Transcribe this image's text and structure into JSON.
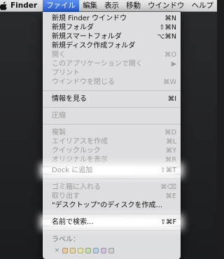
{
  "menubar": {
    "apple_icon": "apple-icon",
    "app_name": "Finder",
    "menus": [
      "ファイル",
      "編集",
      "表示",
      "移動",
      "ウインドウ",
      "ヘルプ"
    ]
  },
  "file_menu": {
    "items": [
      {
        "label": "新規 Finder ウインドウ",
        "shortcut": "⌘N",
        "enabled": true
      },
      {
        "label": "新規フォルダ",
        "shortcut": "⇧⌘N",
        "enabled": true
      },
      {
        "label": "新規スマートフォルダ",
        "shortcut": "⌥⌘N",
        "enabled": true
      },
      {
        "label": "新規ディスク作成フォルダ",
        "shortcut": "",
        "enabled": true
      },
      {
        "label": "開く",
        "shortcut": "⌘O",
        "enabled": false
      },
      {
        "label": "このアプリケーションで開く",
        "shortcut": "▶",
        "enabled": false
      },
      {
        "label": "プリント",
        "shortcut": "",
        "enabled": false
      },
      {
        "label": "ウインドウを閉じる",
        "shortcut": "⌘W",
        "enabled": false
      },
      {
        "label": "情報を見る",
        "shortcut": "⌘I",
        "enabled": true
      },
      {
        "label": "圧縮",
        "shortcut": "",
        "enabled": false
      },
      {
        "label": "複製",
        "shortcut": "⌘D",
        "enabled": false
      },
      {
        "label": "エイリアスを作成",
        "shortcut": "⌘L",
        "enabled": false
      },
      {
        "label": "クイックルック",
        "shortcut": "⌘Y",
        "enabled": false
      },
      {
        "label": "オリジナルを表示",
        "shortcut": "⌘R",
        "enabled": false
      },
      {
        "label": "Dock に追加",
        "shortcut": "⇧⌘T",
        "enabled": false
      },
      {
        "label": "ゴミ箱に入れる",
        "shortcut": "⌘⌫",
        "enabled": false
      },
      {
        "label": "取り出す",
        "shortcut": "⌘E",
        "enabled": false
      },
      {
        "label": "\"デスクトップ\"のディスクを作成...",
        "shortcut": "",
        "enabled": true
      },
      {
        "label": "名前で検索...",
        "shortcut": "⇧⌘F",
        "enabled": true
      }
    ],
    "labels_title": "ラベル：",
    "labels_none": "×",
    "label_colors": [
      "#e8c9a0",
      "#e8d6a0",
      "#e8e4a8",
      "#c6dcaa",
      "#b8cfe6",
      "#d2c2e0",
      "#cfcfcf"
    ]
  }
}
